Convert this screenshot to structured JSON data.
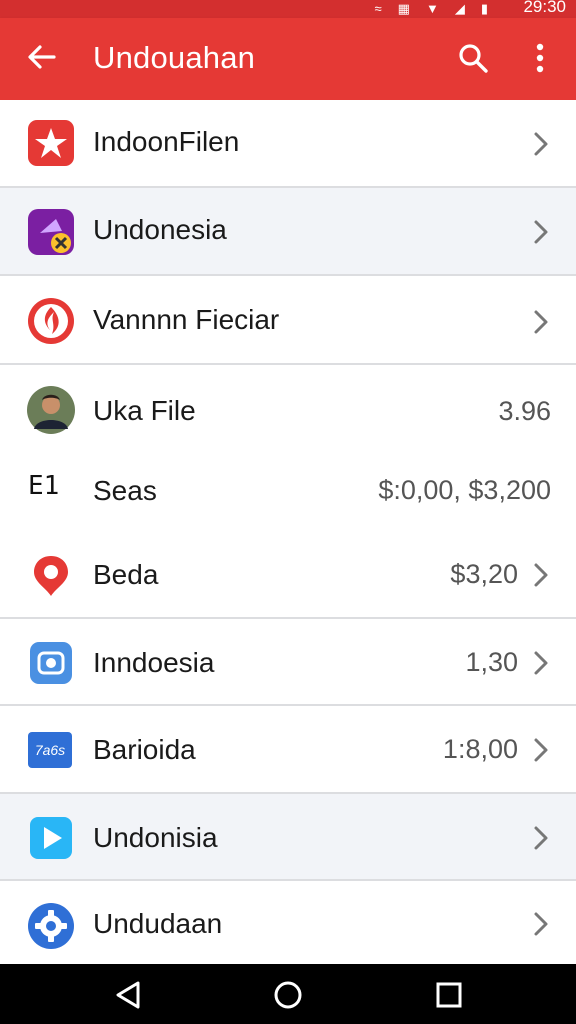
{
  "status": {
    "time": "29:30"
  },
  "header": {
    "title": "Undouahan"
  },
  "items": [
    {
      "label": "IndoonFilen",
      "value": "",
      "icon": "star-icon",
      "shaded": false
    },
    {
      "label": "Undonesia",
      "value": "",
      "icon": "purple-app-icon",
      "shaded": true
    },
    {
      "label": "Vannnn Fieciar",
      "value": "",
      "icon": "flame-logo-icon",
      "shaded": false
    },
    {
      "label": "Uka File",
      "value": "3.96",
      "icon": "avatar-icon",
      "shaded": false
    },
    {
      "label": "Seas",
      "value": "$:0,00, $3,200",
      "icon": "e1-text-icon",
      "shaded": false
    },
    {
      "label": "Beda",
      "value": "$3,20",
      "icon": "location-pin-icon",
      "shaded": false
    },
    {
      "label": "Inndoesia",
      "value": "1,30",
      "icon": "camera-app-icon",
      "shaded": false
    },
    {
      "label": "Barioida",
      "value": "1:8,00",
      "icon": "tag-app-icon",
      "shaded": false
    },
    {
      "label": "Undonisia",
      "value": "",
      "icon": "play-store-icon",
      "shaded": true
    },
    {
      "label": "Undudaan",
      "value": "",
      "icon": "settings-gear-icon",
      "shaded": false
    }
  ],
  "icon_badges": {
    "tag_app": "7a6s",
    "e1_text": "E1"
  },
  "colors": {
    "appbar": "#e53935",
    "statusbar": "#d32f2f",
    "accent_red": "#e53935",
    "navbar": "#000000"
  }
}
